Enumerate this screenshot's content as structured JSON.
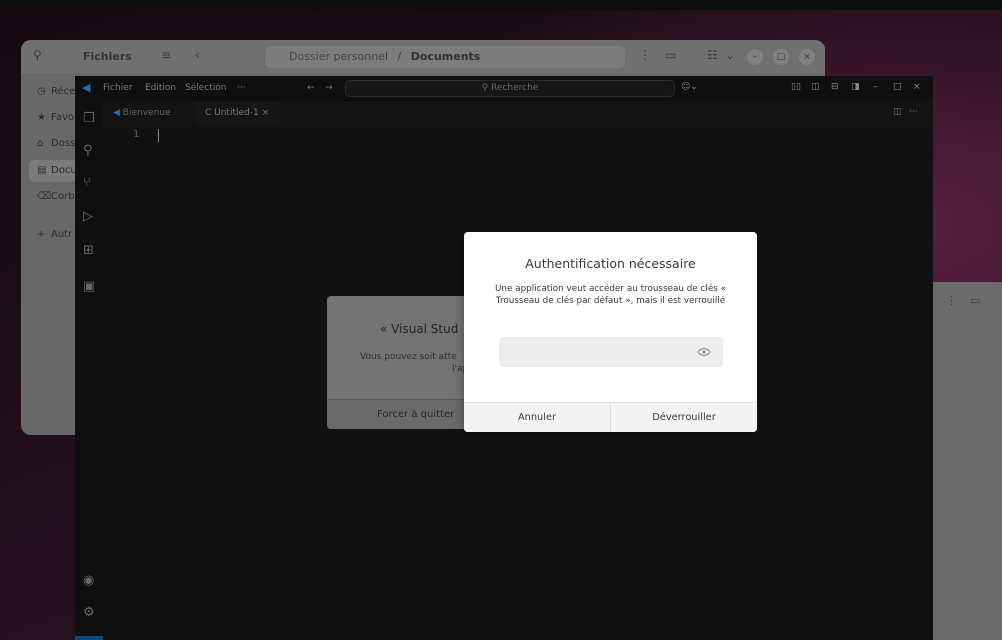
{
  "files_window": {
    "app_title": "Fichiers",
    "path_parent": "Dossier personnel",
    "path_separator": "/",
    "path_current": "Documents",
    "sidebar": [
      {
        "icon": "clock-icon",
        "glyph": "◷",
        "label": "Réce"
      },
      {
        "icon": "star-icon",
        "glyph": "★",
        "label": "Favo"
      },
      {
        "icon": "home-icon",
        "glyph": "⌂",
        "label": "Doss"
      },
      {
        "icon": "document-icon",
        "glyph": "▤",
        "label": "Docu"
      },
      {
        "icon": "trash-icon",
        "glyph": "⌫",
        "label": "Corb"
      },
      {
        "icon": "plus-icon",
        "glyph": "+",
        "label": "Autr"
      }
    ]
  },
  "vscode": {
    "menu": [
      "Fichier",
      "Edition",
      "Sélection",
      "···"
    ],
    "search_placeholder": "Recherche",
    "tabs": [
      {
        "label": "Bienvenue"
      },
      {
        "label": "C  Untitled-1",
        "close": "×"
      }
    ],
    "line_number": "1"
  },
  "force_quit_dialog": {
    "title": "« Visual Stud",
    "text_line1": "Vous pouvez soit atte",
    "text_line2": "l'ap",
    "button": "Forcer à quitter"
  },
  "auth_dialog": {
    "title": "Authentification nécessaire",
    "message": "Une application veut accéder au trousseau de clés « Trousseau de clés par défaut », mais il est verrouillé",
    "password_value": "",
    "cancel": "Annuler",
    "unlock": "Déverrouiller"
  },
  "colors": {
    "wallpaper_accent": "#5a1f3f",
    "dialog_bg": "#ffffff",
    "vscode_bg": "#111111"
  }
}
